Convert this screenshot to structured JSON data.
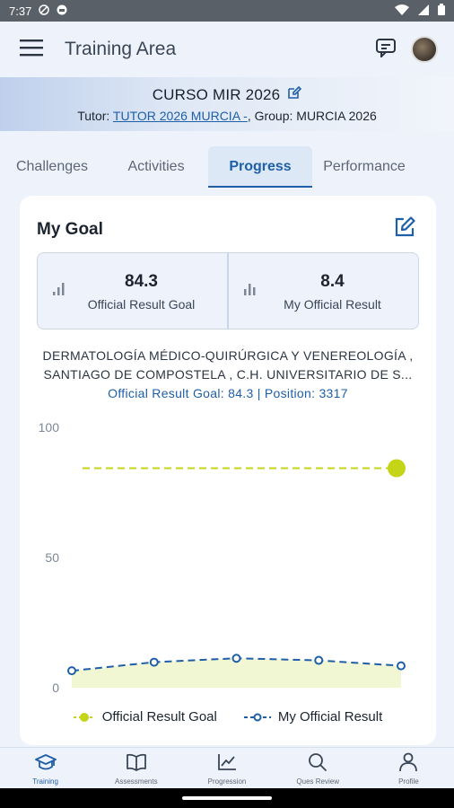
{
  "status_bar": {
    "time": "7:37",
    "icons": [
      "vpn-key-icon",
      "shield-icon",
      "wifi-icon",
      "signal-icon",
      "battery-icon"
    ]
  },
  "app_bar": {
    "title": "Training Area",
    "menu_icon": "hamburger-menu-icon",
    "chat_icon": "chat-icon"
  },
  "course": {
    "name": "CURSO MIR 2026",
    "tutor_label": "Tutor: ",
    "tutor_value": "TUTOR 2026 MURCIA -",
    "group_label": ", Group: ",
    "group_value": "MURCIA 2026"
  },
  "tabs": [
    {
      "label": "Challenges",
      "active": false
    },
    {
      "label": "Activities",
      "active": false
    },
    {
      "label": "Progress",
      "active": true
    },
    {
      "label": "Performance",
      "active": false
    }
  ],
  "goal_card": {
    "title": "My Goal",
    "stats": [
      {
        "value": "84.3",
        "label": "Official Result Goal",
        "icon": "bar-chart-icon"
      },
      {
        "value": "8.4",
        "label": "My Official Result",
        "icon": "bar-chart-icon"
      }
    ],
    "specialty_line1": "DERMATOLOGÍA MÉDICO-QUIRÚRGICA Y VENEREOLOGÍA ,",
    "specialty_line2": "SANTIAGO DE COMPOSTELA , C.H. UNIVERSITARIO DE S...",
    "goal_line": "Official Result Goal: 84.3 | Position: 3317"
  },
  "chart_data": {
    "type": "line",
    "y_ticks": [
      "100",
      "50",
      "0"
    ],
    "ylim": [
      0,
      100
    ],
    "series": [
      {
        "name": "Official Result Goal",
        "color": "#c4d417",
        "style": "dashed",
        "values": [
          84.3,
          84.3,
          84.3,
          84.3,
          84.3,
          84.3,
          84.3,
          84.3
        ]
      },
      {
        "name": "My Official Result",
        "color": "#1f5fa8",
        "style": "dashed",
        "values": [
          6.5,
          9.8,
          11.3,
          10.5,
          8.4
        ]
      }
    ],
    "grid": false
  },
  "bottom_nav": [
    {
      "label": "Training",
      "icon": "graduation-cap-icon",
      "active": true
    },
    {
      "label": "Assessments",
      "icon": "book-icon",
      "active": false
    },
    {
      "label": "Progression",
      "icon": "line-chart-icon",
      "active": false
    },
    {
      "label": "Ques Review",
      "icon": "search-icon",
      "active": false
    },
    {
      "label": "Profile",
      "icon": "person-icon",
      "active": false
    }
  ]
}
